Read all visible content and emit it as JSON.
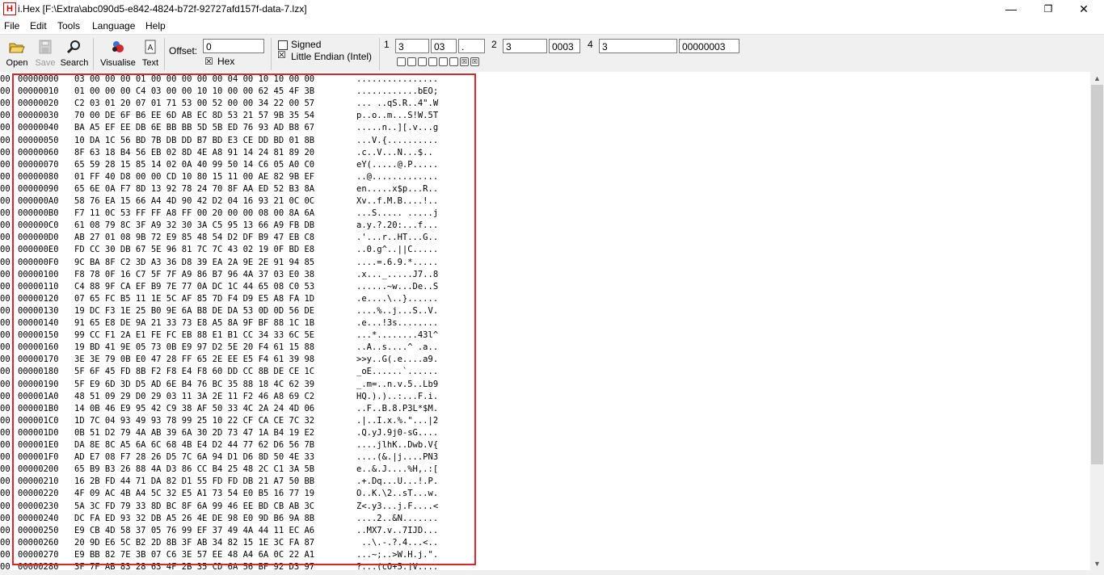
{
  "window": {
    "icon_letter": "H",
    "title": "i.Hex [F:\\Extra\\abc090d5-e842-4824-b72f-92727afd157f-data-7.lzx]",
    "minimize": "—",
    "restore": "❐",
    "close": "✕"
  },
  "menu": [
    "File",
    "Edit",
    "Tools",
    "Language",
    "Help"
  ],
  "toolbar": {
    "open": "Open",
    "save": "Save",
    "search": "Search",
    "visualise": "Visualise",
    "text": "Text",
    "offset_label": "Offset:",
    "offset_value": "0",
    "hex_label": "Hex",
    "hex_checked": "☒",
    "signed_label": "Signed",
    "little_endian_label": "Little Endian (Intel)",
    "little_endian_checked": "☒",
    "group1_label": "1",
    "group1_val_a": "3",
    "group1_val_b": "03",
    "group1_val_c": ".",
    "group2_label": "2",
    "group2_val_a": "3",
    "group2_val_b": "0003",
    "group4_label": "4",
    "group4_val_a": "3",
    "group4_val_b": "00000003",
    "bits": [
      "",
      "",
      "",
      "",
      "",
      "",
      "☒",
      "☒"
    ]
  },
  "gutter": "00",
  "rows": [
    {
      "addr": "00000000",
      "bytes": "03 00 00 00 01 00 00 00 00 00 04 00 10 10 00 00",
      "ascii": "................"
    },
    {
      "addr": "00000010",
      "bytes": "01 00 00 00 C4 03 00 00 10 10 00 00 62 45 4F 3B",
      "ascii": "............bEO;"
    },
    {
      "addr": "00000020",
      "bytes": "C2 03 01 20 07 01 71 53 00 52 00 00 34 22 00 57",
      "ascii": "... ..qS.R..4\".W"
    },
    {
      "addr": "00000030",
      "bytes": "70 00 DE 6F B6 EE 6D AB EC 8D 53 21 57 9B 35 54",
      "ascii": "p..o..m...S!W.5T"
    },
    {
      "addr": "00000040",
      "bytes": "BA A5 EF EE DB 6E BB BB 5D 5B ED 76 93 AD B8 67",
      "ascii": ".....n..][.v...g"
    },
    {
      "addr": "00000050",
      "bytes": "10 DA 1C 56 BD 7B DB DD B7 BD E3 CE DD BD 01 8B",
      "ascii": "...V.{.........."
    },
    {
      "addr": "00000060",
      "bytes": "8F 63 18 B4 56 EB 02 8D 4E A8 91 14 24 81 89 20",
      "ascii": ".c..V...N...$.. "
    },
    {
      "addr": "00000070",
      "bytes": "65 59 28 15 85 14 02 0A 40 99 50 14 C6 05 A0 C0",
      "ascii": "eY(.....@.P....."
    },
    {
      "addr": "00000080",
      "bytes": "01 FF 40 D8 00 00 CD 10 80 15 11 00 AE 82 9B EF",
      "ascii": "..@............."
    },
    {
      "addr": "00000090",
      "bytes": "65 6E 0A F7 8D 13 92 78 24 70 8F AA ED 52 B3 8A",
      "ascii": "en.....x$p...R.."
    },
    {
      "addr": "000000A0",
      "bytes": "58 76 EA 15 66 A4 4D 90 42 D2 04 16 93 21 0C 0C",
      "ascii": "Xv..f.M.B....!.."
    },
    {
      "addr": "000000B0",
      "bytes": "F7 11 0C 53 FF FF A8 FF 00 20 00 00 08 00 8A 6A",
      "ascii": "...S..... .....j"
    },
    {
      "addr": "000000C0",
      "bytes": "61 08 79 8C 3F A9 32 30 3A C5 95 13 66 A9 FB DB",
      "ascii": "a.y.?.20:...f..."
    },
    {
      "addr": "000000D0",
      "bytes": "AB 27 01 08 9B 72 E9 85 48 54 D2 DF B9 47 EB C8",
      "ascii": ".'...r..HT...G.."
    },
    {
      "addr": "000000E0",
      "bytes": "FD CC 30 DB 67 5E 96 81 7C 7C 43 02 19 0F BD E8",
      "ascii": "..0.g^..||C....."
    },
    {
      "addr": "000000F0",
      "bytes": "9C BA 8F C2 3D A3 36 D8 39 EA 2A 9E 2E 91 94 85",
      "ascii": "....=.6.9.*....."
    },
    {
      "addr": "00000100",
      "bytes": "F8 78 0F 16 C7 5F 7F A9 86 B7 96 4A 37 03 E0 38",
      "ascii": ".x..._.....J7..8"
    },
    {
      "addr": "00000110",
      "bytes": "C4 88 9F CA EF B9 7E 77 0A DC 1C 44 65 08 C0 53",
      "ascii": "......~w...De..S"
    },
    {
      "addr": "00000120",
      "bytes": "07 65 FC B5 11 1E 5C AF 85 7D F4 D9 E5 A8 FA 1D",
      "ascii": ".e....\\..}......"
    },
    {
      "addr": "00000130",
      "bytes": "19 DC F3 1E 25 B0 9E 6A B8 DE DA 53 0D 0D 56 DE",
      "ascii": "....%..j...S..V."
    },
    {
      "addr": "00000140",
      "bytes": "91 65 E8 DE 9A 21 33 73 E8 A5 8A 9F BF 88 1C 1B",
      "ascii": ".e...!3s........"
    },
    {
      "addr": "00000150",
      "bytes": "99 CC F1 2A E1 FE FC EB 88 E1 B1 CC 34 33 6C 5E",
      "ascii": "...*........43l^"
    },
    {
      "addr": "00000160",
      "bytes": "19 BD 41 9E 05 73 0B E9 97 D2 5E 20 F4 61 15 88",
      "ascii": "..A..s....^ .a.."
    },
    {
      "addr": "00000170",
      "bytes": "3E 3E 79 0B E0 47 28 FF 65 2E EE E5 F4 61 39 98",
      "ascii": ">>y..G(.e....a9."
    },
    {
      "addr": "00000180",
      "bytes": "5F 6F 45 FD 8B F2 F8 E4 F8 60 DD CC 8B DE CE 1C",
      "ascii": "_oE......`......"
    },
    {
      "addr": "00000190",
      "bytes": "5F E9 6D 3D D5 AD 6E B4 76 BC 35 88 18 4C 62 39",
      "ascii": "_.m=..n.v.5..Lb9"
    },
    {
      "addr": "000001A0",
      "bytes": "48 51 09 29 D0 29 03 11 3A 2E 11 F2 46 A8 69 C2",
      "ascii": "HQ.).)..:...F.i."
    },
    {
      "addr": "000001B0",
      "bytes": "14 0B 46 E9 95 42 C9 38 AF 50 33 4C 2A 24 4D 06",
      "ascii": "..F..B.8.P3L*$M."
    },
    {
      "addr": "000001C0",
      "bytes": "1D 7C 04 93 49 93 78 99 25 10 22 CF CA CE 7C 32",
      "ascii": ".|..I.x.%.\"...|2"
    },
    {
      "addr": "000001D0",
      "bytes": "0B 51 D2 79 4A AB 39 6A 30 2D 73 47 1A B4 19 E2",
      "ascii": ".Q.yJ.9j0-sG...."
    },
    {
      "addr": "000001E0",
      "bytes": "DA 8E 8C A5 6A 6C 68 4B E4 D2 44 77 62 D6 56 7B",
      "ascii": "....jlhK..Dwb.V{"
    },
    {
      "addr": "000001F0",
      "bytes": "AD E7 08 F7 28 26 D5 7C 6A 94 D1 D6 8D 50 4E 33",
      "ascii": "....(&.|j....PN3"
    },
    {
      "addr": "00000200",
      "bytes": "65 B9 B3 26 88 4A D3 86 CC B4 25 48 2C C1 3A 5B",
      "ascii": "e..&.J....%H,.:["
    },
    {
      "addr": "00000210",
      "bytes": "16 2B FD 44 71 DA 82 D1 55 FD FD DB 21 A7 50 BB",
      "ascii": ".+.Dq...U...!.P."
    },
    {
      "addr": "00000220",
      "bytes": "4F 09 AC 4B A4 5C 32 E5 A1 73 54 E0 B5 16 77 19",
      "ascii": "O..K.\\2..sT...w."
    },
    {
      "addr": "00000230",
      "bytes": "5A 3C FD 79 33 8D BC 8F 6A 99 46 EE BD CB AB 3C",
      "ascii": "Z<.y3...j.F....<"
    },
    {
      "addr": "00000240",
      "bytes": "DC FA ED 93 32 DB A5 26 4E DE 98 E0 9D B6 9A 8B",
      "ascii": "....2..&N......."
    },
    {
      "addr": "00000250",
      "bytes": "E9 CB 4D 58 37 05 76 99 EF 37 49 4A 44 11 EC A6",
      "ascii": "..MX7.v..7IJD..."
    },
    {
      "addr": "00000260",
      "bytes": "20 9D E6 5C B2 2D 8B 3F AB 34 82 15 1E 3C FA 87",
      "ascii": " ..\\.-.?.4...<.."
    },
    {
      "addr": "00000270",
      "bytes": "E9 BB 82 7E 3B 07 C6 3E 57 EE 48 A4 6A 0C 22 A1",
      "ascii": "...~;..>W.H.j.\"."
    },
    {
      "addr": "00000280",
      "bytes": "3F 7F AB 83 28 63 4F 2B 35 CD 6A 56 BF 92 D3 97",
      "ascii": "?...(cO+5.jV...."
    }
  ]
}
